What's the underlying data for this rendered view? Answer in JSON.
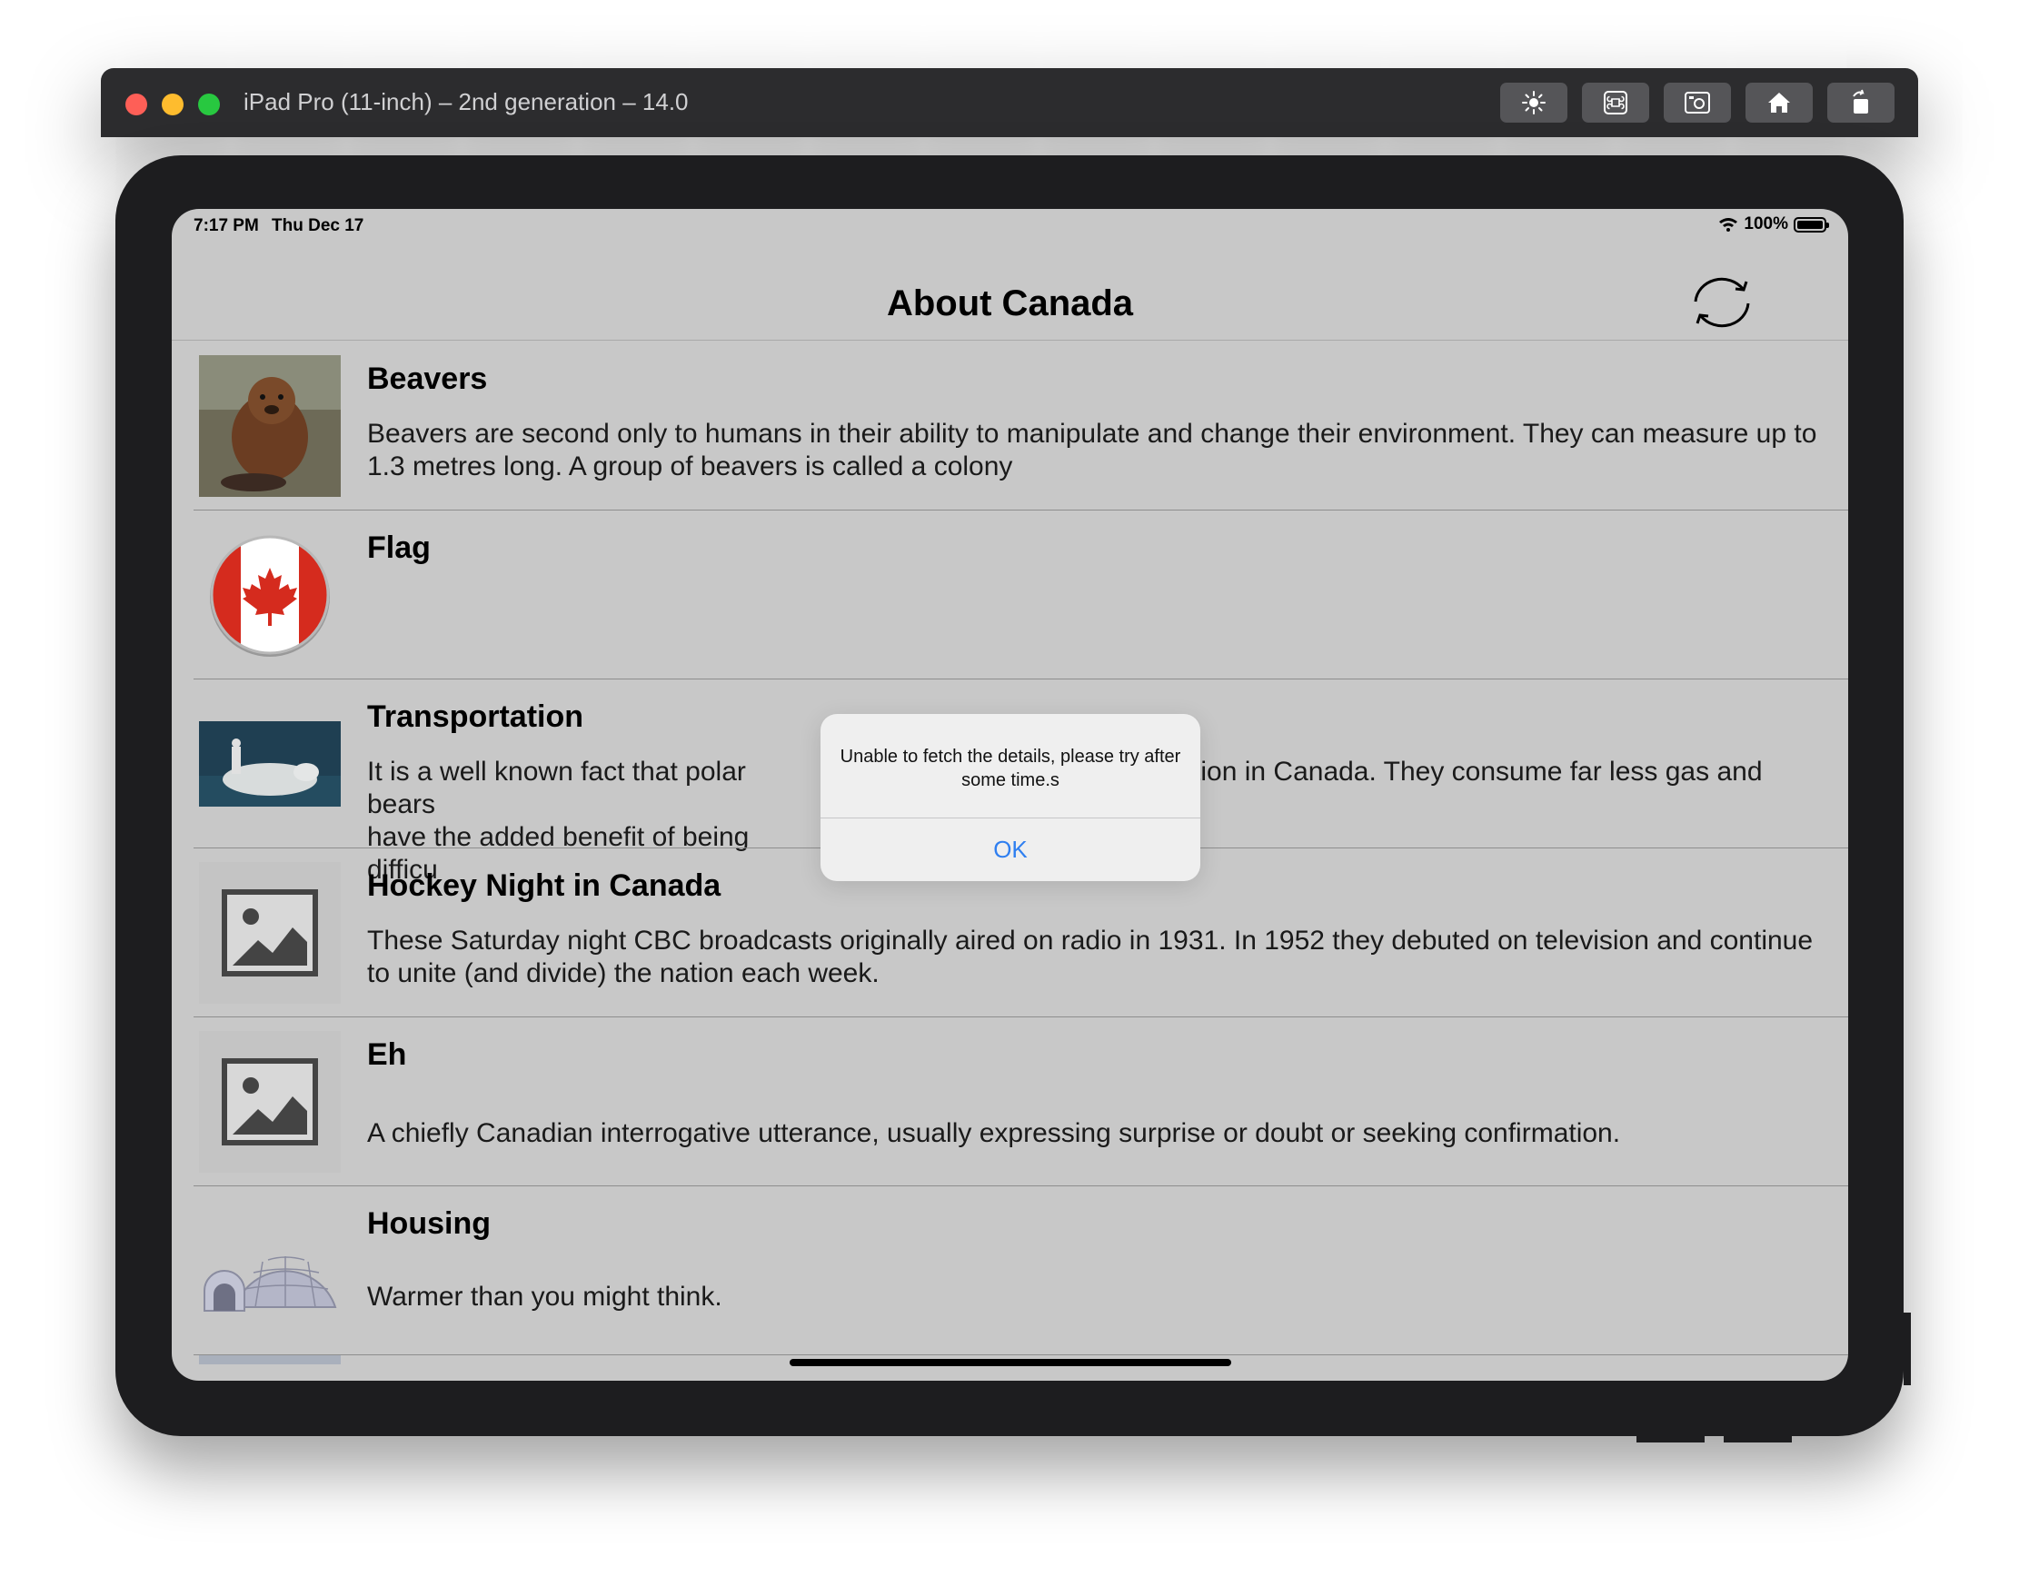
{
  "simulator": {
    "title": "iPad Pro (11-inch) – 2nd generation – 14.0",
    "toolbar_icons": [
      "brightness-icon",
      "command-icon",
      "screenshot-icon",
      "home-icon",
      "rotate-icon"
    ]
  },
  "status_bar": {
    "time": "7:17 PM",
    "date": "Thu Dec 17",
    "battery": "100%"
  },
  "nav": {
    "title": "About Canada"
  },
  "rows": [
    {
      "title": "Beavers",
      "description": "Beavers are second only to humans in their ability to manipulate and change their environment. They can measure up to 1.3 metres long. A group of beavers is called a colony"
    },
    {
      "title": "Flag",
      "description": ""
    },
    {
      "title": "Transportation",
      "description_left": "It is a well known fact that polar bears",
      "description_left_2": "have the added benefit of being difficu",
      "description_right": "tation in Canada. They consume far less gas and"
    },
    {
      "title": "Hockey Night in Canada",
      "description": "These Saturday night CBC broadcasts originally aired on radio in 1931. In 1952 they debuted on television and continue to unite (and divide) the nation each week."
    },
    {
      "title": "Eh",
      "description": "A chiefly Canadian interrogative utterance, usually expressing surprise or doubt or seeking confirmation."
    },
    {
      "title": "Housing",
      "description": "Warmer than you might think."
    }
  ],
  "alert": {
    "message": "Unable to fetch the details, please try after some time.s",
    "ok_label": "OK"
  },
  "colors": {
    "screen_background": "#c8c8c8",
    "alert_button": "#2f7ff0",
    "flag_red": "#d52b1e"
  }
}
